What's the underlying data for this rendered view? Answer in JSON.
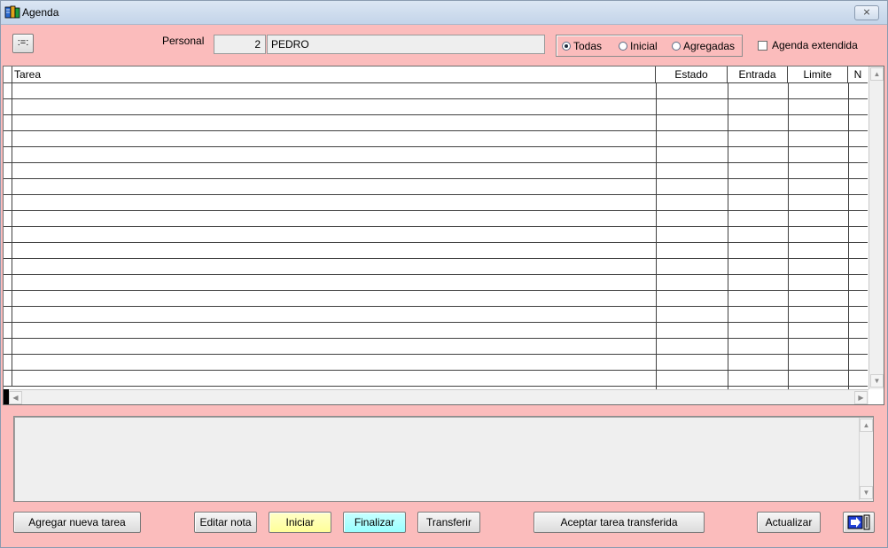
{
  "window": {
    "title": "Agenda",
    "close_label": "⨯"
  },
  "toolbar": {
    "menu_label": ":=:"
  },
  "personal": {
    "label": "Personal",
    "number": "2",
    "name": "PEDRO"
  },
  "filter": {
    "options": [
      {
        "label": "Todas",
        "selected": true
      },
      {
        "label": "Inicial",
        "selected": false
      },
      {
        "label": "Agregadas",
        "selected": false
      }
    ],
    "extended_label": "Agenda extendida",
    "extended_checked": false
  },
  "grid": {
    "columns": [
      {
        "label": "Tarea"
      },
      {
        "label": "Estado"
      },
      {
        "label": "Entrada"
      },
      {
        "label": "Limite"
      },
      {
        "label": "N"
      }
    ],
    "rows": []
  },
  "buttons": {
    "agregar": "Agregar nueva tarea",
    "editar": "Editar nota",
    "iniciar": "Iniciar",
    "finalizar": "Finalizar",
    "transferir": "Transferir",
    "aceptar": "Aceptar tarea transferida",
    "actualizar": "Actualizar"
  },
  "icons": {
    "app": "agenda-app-icon",
    "exit": "exit-door-icon"
  },
  "colors": {
    "form_background": "#fbbcbc",
    "iniciar_button": "#ffff99",
    "finalizar_button": "#99ffff"
  }
}
